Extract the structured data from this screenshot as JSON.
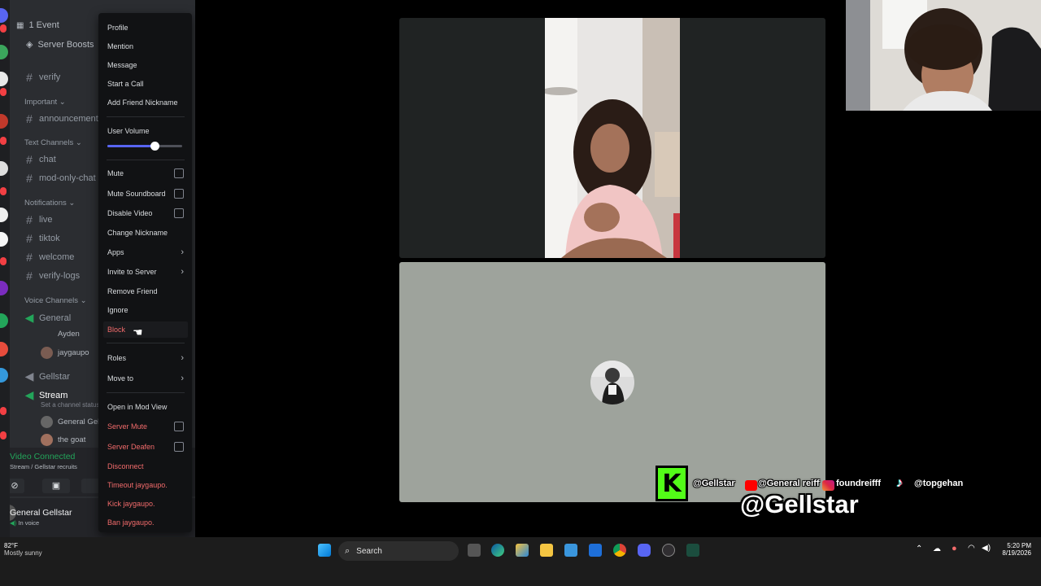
{
  "sidebar": {
    "top_items": [
      {
        "label": "1 Event",
        "icon": "calendar-icon"
      },
      {
        "label": "Server Boosts",
        "icon": "boost-icon"
      }
    ],
    "channels": [
      {
        "name": "verify"
      },
      {
        "name": "announcements"
      },
      {
        "name": "chat"
      },
      {
        "name": "mod-only-chat"
      },
      {
        "name": "live"
      },
      {
        "name": "tiktok"
      },
      {
        "name": "welcome"
      },
      {
        "name": "verify-logs"
      }
    ],
    "categories": {
      "important": "Important",
      "text": "Text Channels",
      "notifications": "Notifications",
      "voice": "Voice Channels"
    },
    "voice_channels": [
      {
        "name": "General"
      },
      {
        "name": "Gellstar"
      },
      {
        "name": "Stream"
      }
    ],
    "members": [
      {
        "name": "Ayden"
      },
      {
        "name": "jaygaupo"
      },
      {
        "name": "General Gel"
      },
      {
        "name": "the goat"
      }
    ],
    "stream_status": "Set a channel status",
    "voice_status": {
      "title": "Video Connected",
      "subtitle": "Stream / Gellstar recruits"
    },
    "user": {
      "name": "General Gellstar",
      "status": "In voice"
    }
  },
  "context_menu": {
    "items": [
      {
        "label": "Profile",
        "kind": "plain"
      },
      {
        "label": "Mention",
        "kind": "plain"
      },
      {
        "label": "Message",
        "kind": "plain"
      },
      {
        "label": "Start a Call",
        "kind": "plain"
      },
      {
        "label": "Add Friend Nickname",
        "kind": "plain"
      },
      {
        "label": "User Volume",
        "kind": "slider"
      },
      {
        "label": "Mute",
        "kind": "checkbox"
      },
      {
        "label": "Mute Soundboard",
        "kind": "checkbox"
      },
      {
        "label": "Disable Video",
        "kind": "checkbox"
      },
      {
        "label": "Change Nickname",
        "kind": "plain"
      },
      {
        "label": "Apps",
        "kind": "submenu"
      },
      {
        "label": "Invite to Server",
        "kind": "submenu"
      },
      {
        "label": "Remove Friend",
        "kind": "plain"
      },
      {
        "label": "Ignore",
        "kind": "plain"
      },
      {
        "label": "Block",
        "kind": "danger"
      },
      {
        "label": "Roles",
        "kind": "submenu"
      },
      {
        "label": "Move to",
        "kind": "submenu"
      },
      {
        "label": "Open in Mod View",
        "kind": "plain"
      },
      {
        "label": "Server Mute",
        "kind": "danger-checkbox"
      },
      {
        "label": "Server Deafen",
        "kind": "danger-checkbox"
      },
      {
        "label": "Disconnect",
        "kind": "danger"
      },
      {
        "label": "Timeout jaygaupo.",
        "kind": "danger"
      },
      {
        "label": "Kick jaygaupo.",
        "kind": "danger"
      },
      {
        "label": "Ban jaygaupo.",
        "kind": "danger"
      }
    ],
    "user_volume_fraction": 0.63
  },
  "overlay": {
    "kick_handle": "@Gellstar",
    "youtube_handle": "@General reiff",
    "instagram_handle": "foundreifff",
    "tiktok_handle": "@topgehan",
    "big_handle": "@Gellstar",
    "kick_letter": "K"
  },
  "weather": {
    "temp": "82°F",
    "condition": "Mostly sunny"
  },
  "taskbar": {
    "search_label": "Search",
    "time": "5:20 PM",
    "date": "8/19/2026"
  },
  "colors": {
    "accent": "#5865f2",
    "danger": "#f26b6b",
    "voice_green": "#23a55a",
    "kick_green": "#53fc18"
  }
}
